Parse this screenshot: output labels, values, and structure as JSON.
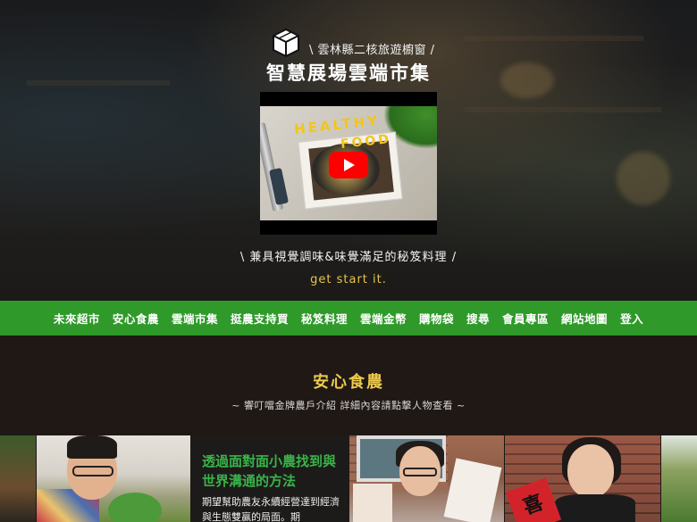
{
  "header": {
    "tagline": "\\ 雲林縣二核旅遊櫥窗 /",
    "site_title": "智慧展場雲端市集",
    "logo_icon": "box-logo-icon"
  },
  "video": {
    "text_line1": "HEALTHY",
    "text_line2": "FOOD",
    "play_icon": "youtube-play-icon"
  },
  "hero": {
    "subtitle": "\\ 兼具視覺調味&味覺滿足的秘笈料理 /",
    "cta": "get start it."
  },
  "nav": {
    "items": [
      "未來超市",
      "安心食農",
      "雲端市集",
      "挺農支持買",
      "秘笈料理",
      "雲端金幣",
      "購物袋",
      "搜尋",
      "會員專區",
      "網站地圖",
      "登入"
    ]
  },
  "section": {
    "title": "安心食農",
    "description": "~ 響叮噹金牌農戶介紹 詳細內容請點擊人物查看 ~"
  },
  "gallery": {
    "card_title": "透過面對面小農找到與世界溝通的方法",
    "card_body": "期望幫助農友永續經營達到經濟與生態雙贏的局面。期",
    "sign_char": "喜"
  },
  "colors": {
    "nav_bg": "#2f9a2a",
    "accent_gold": "#ecc94d",
    "card_title_green": "#39b34a",
    "youtube_red": "#ff0000"
  }
}
